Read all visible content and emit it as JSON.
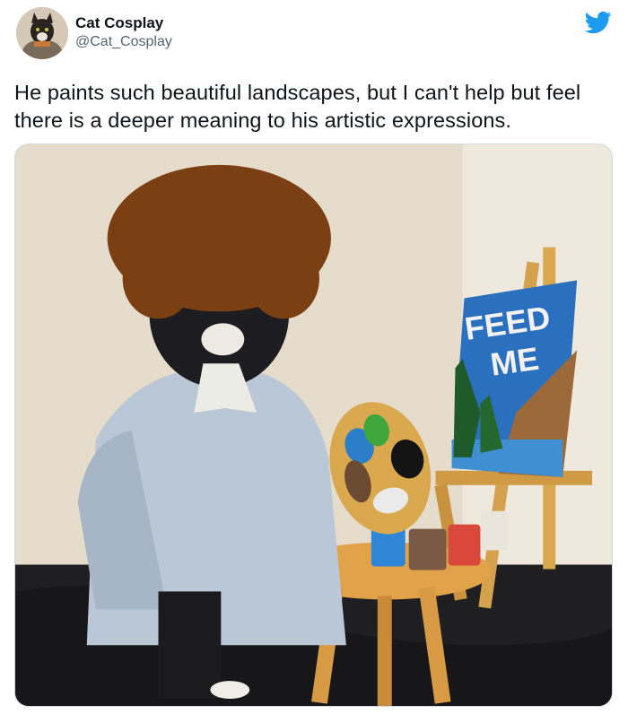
{
  "tweet": {
    "display_name": "Cat Cosplay",
    "handle": "@Cat_Cosplay",
    "text": "He paints such beautiful landscapes, but I can't help but feel there is a deeper meaning to his artistic expressions.",
    "media": {
      "canvas_text_line1": "FEED",
      "canvas_text_line2": "ME"
    }
  },
  "icons": {
    "brand": "twitter-bird-icon"
  },
  "colors": {
    "twitter_blue": "#1d9bf0",
    "text": "#0f1419",
    "secondary_text": "#536471"
  }
}
